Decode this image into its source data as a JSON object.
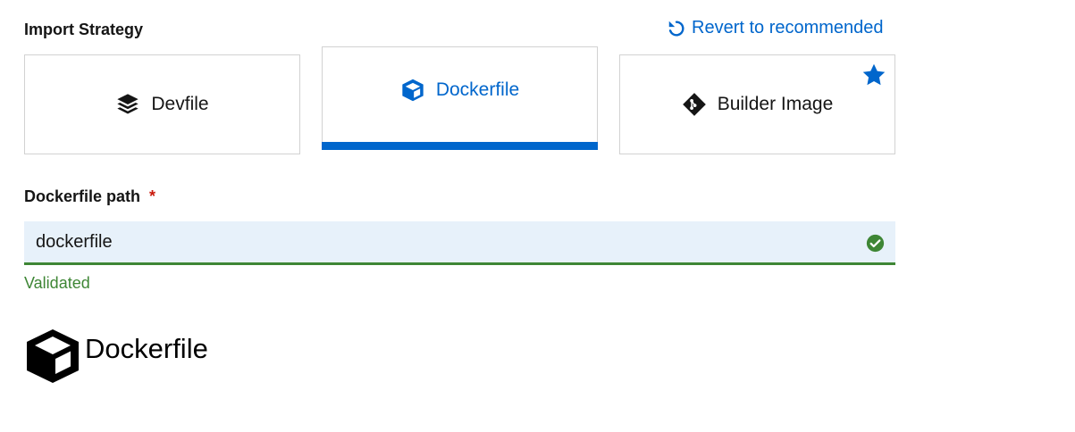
{
  "header": {
    "title": "Import Strategy",
    "revert_label": "Revert to recommended"
  },
  "strategies": [
    {
      "label": "Devfile",
      "icon": "layers-icon",
      "selected": false
    },
    {
      "label": "Dockerfile",
      "icon": "cube-icon",
      "selected": true
    },
    {
      "label": "Builder Image",
      "icon": "git-icon",
      "selected": false,
      "recommended": true
    }
  ],
  "dockerfile_path": {
    "label": "Dockerfile path",
    "required_marker": "*",
    "value": "dockerfile",
    "helper": "Validated",
    "status": "success"
  },
  "brand": {
    "label": "Dockerfile",
    "icon": "dockerfile-cube-icon"
  },
  "colors": {
    "accent": "#0066cc",
    "success": "#3e8635",
    "required": "#c9190b",
    "input_bg": "#e7f1fa"
  }
}
